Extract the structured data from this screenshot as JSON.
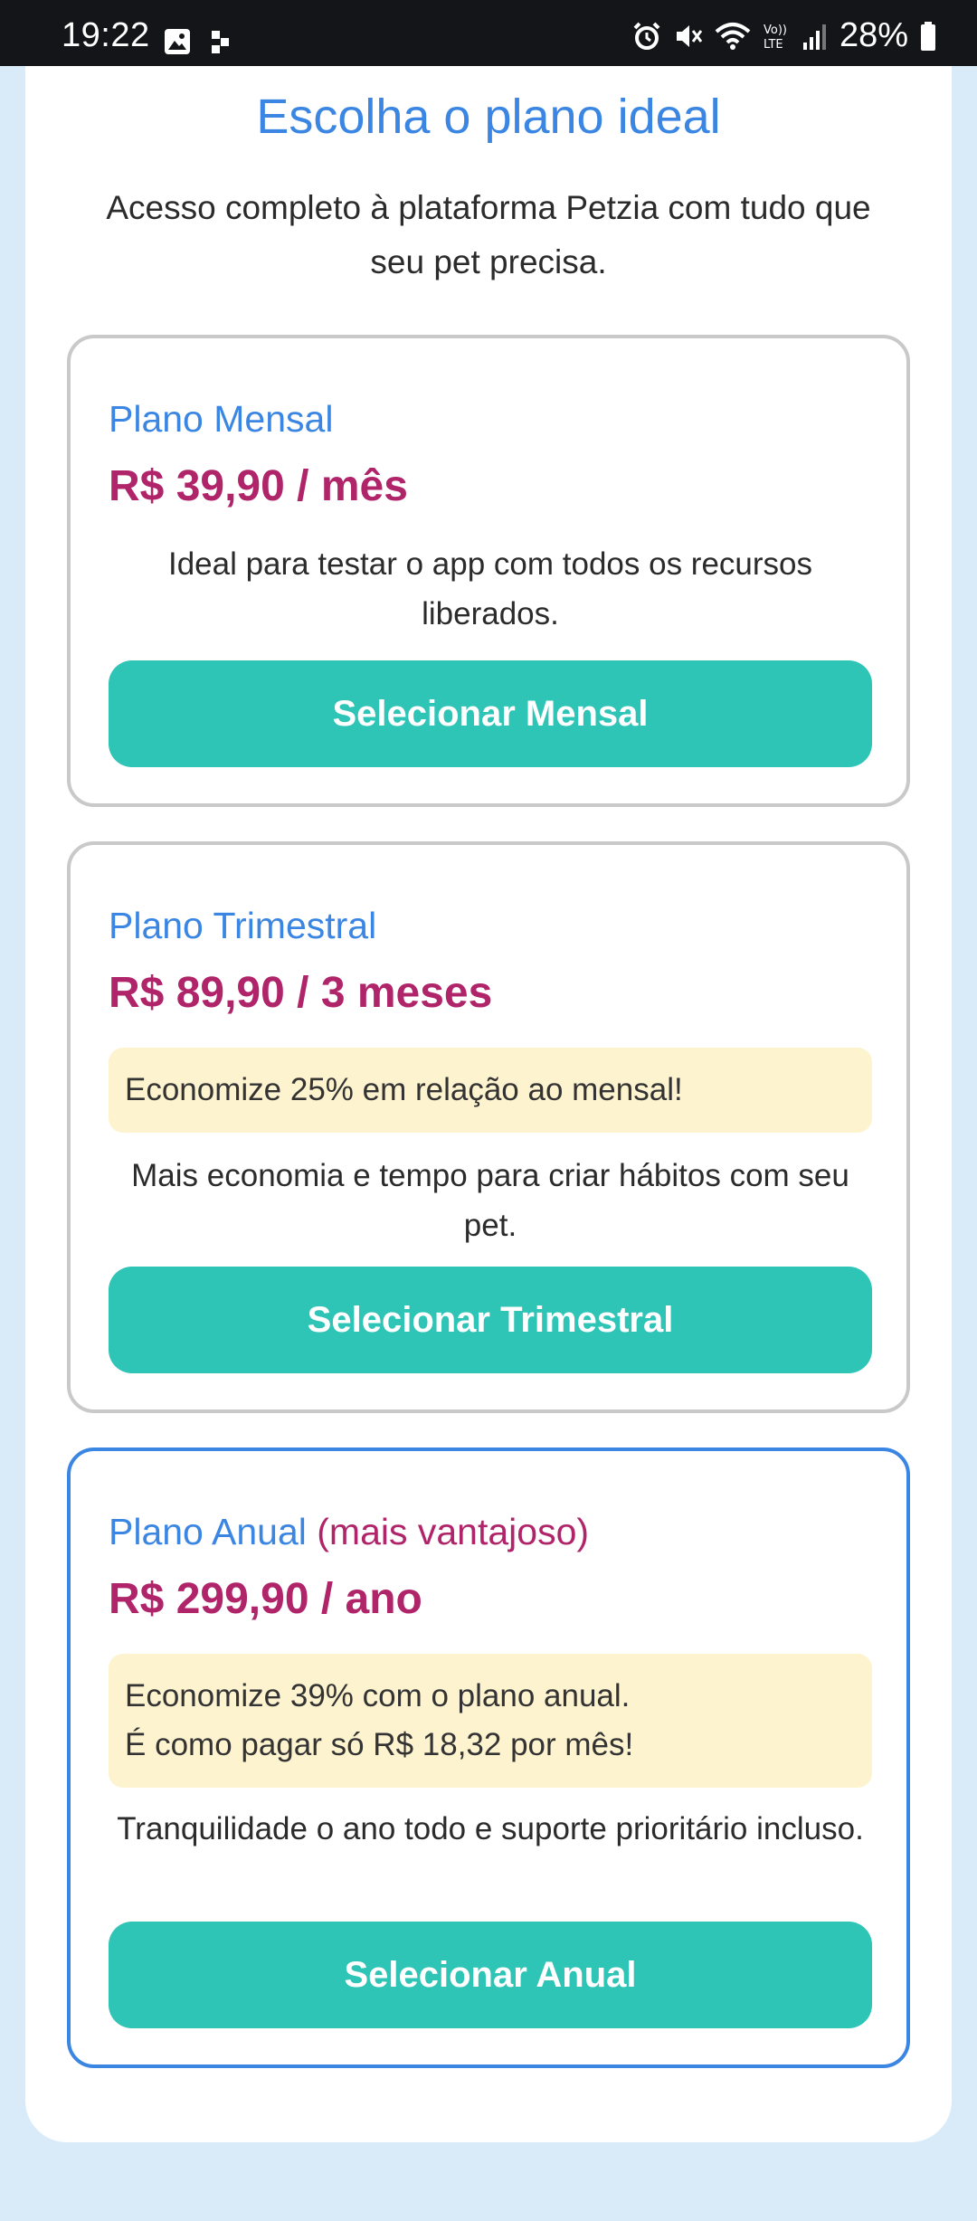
{
  "status_bar": {
    "time": "19:22",
    "battery": "28%",
    "icons": [
      "image-icon",
      "notification-dots-icon",
      "alarm-icon",
      "mute-icon",
      "wifi-icon",
      "volte-icon",
      "signal-icon",
      "battery-icon"
    ]
  },
  "header": {
    "title": "Escolha o plano ideal",
    "subtitle": "Acesso completo à plataforma Petzia com tudo que seu pet precisa."
  },
  "plans": [
    {
      "name": "Plano Mensal",
      "tag": "",
      "price": "R$ 39,90 / mês",
      "savings": [],
      "description": "Ideal para testar o app com todos os recursos liberados.",
      "button": "Selecionar Mensal"
    },
    {
      "name": "Plano Trimestral",
      "tag": "",
      "price": "R$ 89,90 / 3 meses",
      "savings": [
        "Economize 25% em relação ao mensal!"
      ],
      "description": "Mais economia e tempo para criar hábitos com seu pet.",
      "button": "Selecionar Trimestral"
    },
    {
      "name": "Plano Anual",
      "tag": "(mais vantajoso)",
      "price": "R$ 299,90 / ano",
      "savings": [
        "Economize 39% com o plano anual.",
        "É como pagar só R$ 18,32 por mês!"
      ],
      "description": "Tranquilidade o ano todo e suporte prioritário incluso.",
      "button": "Selecionar Anual"
    }
  ],
  "colors": {
    "accent_blue": "#3a86e2",
    "price_magenta": "#b0246a",
    "button_teal": "#2ec4b6",
    "savings_bg": "#fef3cf",
    "page_bg": "#d9ebf9"
  }
}
